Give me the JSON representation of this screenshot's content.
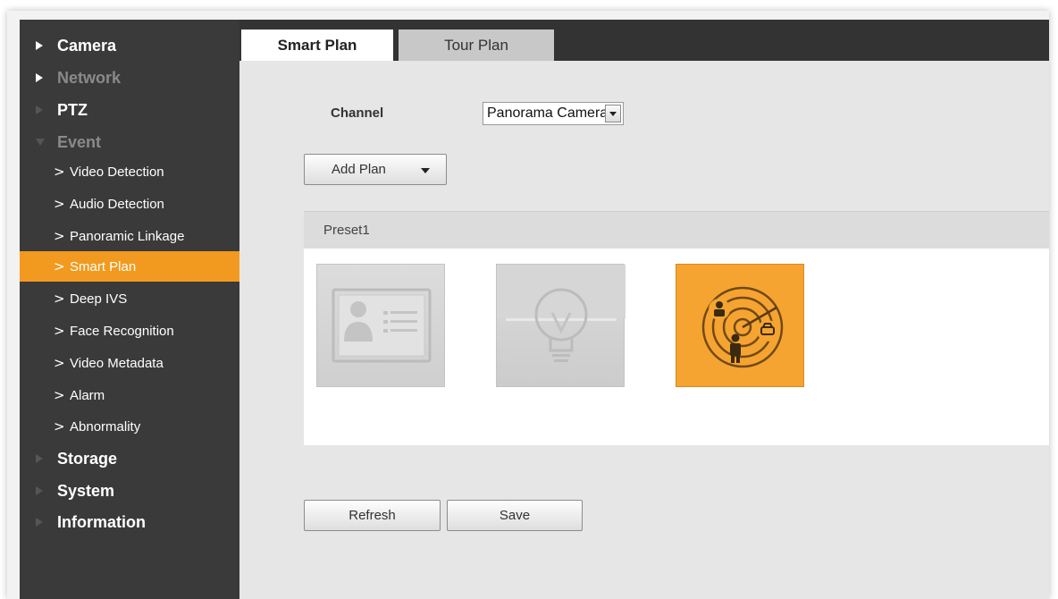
{
  "sidebar": {
    "items": [
      {
        "label": "Camera",
        "kind": "top"
      },
      {
        "label": "Network",
        "kind": "top"
      },
      {
        "label": "PTZ",
        "kind": "top"
      },
      {
        "label": "Event",
        "kind": "top"
      },
      {
        "label": "Video Detection",
        "kind": "sub"
      },
      {
        "label": "Audio Detection",
        "kind": "sub"
      },
      {
        "label": "Panoramic Linkage",
        "kind": "sub"
      },
      {
        "label": "Smart Plan",
        "kind": "sub",
        "active": true
      },
      {
        "label": "Deep IVS",
        "kind": "sub"
      },
      {
        "label": "Face Recognition",
        "kind": "sub"
      },
      {
        "label": "Video Metadata",
        "kind": "sub"
      },
      {
        "label": "Alarm",
        "kind": "sub"
      },
      {
        "label": "Abnormality",
        "kind": "sub"
      },
      {
        "label": "Storage",
        "kind": "top"
      },
      {
        "label": "System",
        "kind": "top"
      },
      {
        "label": "Information",
        "kind": "top"
      }
    ],
    "chevron": ">"
  },
  "tabs": {
    "smart_plan": "Smart Plan",
    "tour_plan": "Tour Plan"
  },
  "channel": {
    "label": "Channel",
    "selected": "Panorama Camera"
  },
  "add_plan": {
    "label": "Add Plan"
  },
  "preset": {
    "title": "Preset1",
    "plans": [
      {
        "icon": "face-recognition-icon",
        "selected": false
      },
      {
        "icon": "ivs-lightbulb-icon",
        "selected": false
      },
      {
        "icon": "video-metadata-radar-icon",
        "selected": true
      }
    ]
  },
  "buttons": {
    "refresh": "Refresh",
    "save": "Save"
  },
  "colors": {
    "accent": "#f29a1f",
    "sidebar_bg": "#3a3a3a",
    "topbar_bg": "#333333"
  }
}
